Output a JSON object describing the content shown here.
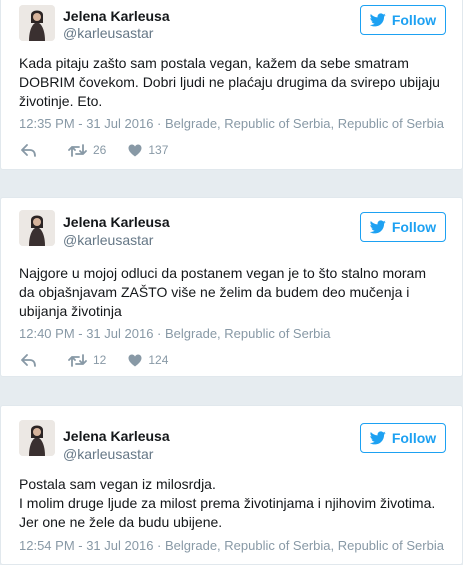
{
  "colors": {
    "accent": "#1da1f2",
    "muted": "#8899a6",
    "background": "#e6ecf0"
  },
  "tweets": [
    {
      "name": "Jelena Karleusa",
      "handle": "@karleusastar",
      "follow_label": "Follow",
      "text": "Kada pitaju zašto sam postala vegan, kažem da sebe smatram DOBRIM čovekom. Dobri ljudi ne plaćaju drugima da svirepo ubijaju životinje. Eto.",
      "time": "12:35 PM - 31 Jul 2016",
      "separator": "·",
      "location": "Belgrade, Republic of Serbia, Republic of Serbia",
      "retweets": "26",
      "likes": "137"
    },
    {
      "name": "Jelena Karleusa",
      "handle": "@karleusastar",
      "follow_label": "Follow",
      "text": "Najgore u mojoj odluci da postanem vegan je to što stalno moram da objašnjavam ZAŠTO više ne želim da budem deo mučenja i ubijanja životinja",
      "time": "12:40 PM - 31 Jul 2016",
      "separator": "·",
      "location": "Belgrade, Republic of Serbia",
      "retweets": "12",
      "likes": "124"
    },
    {
      "name": "Jelena Karleusa",
      "handle": "@karleusastar",
      "follow_label": "Follow",
      "text_lines": [
        "Postala sam vegan iz milosrdja.",
        "I molim druge ljude za milost prema životinjama i njihovim životima.",
        "Jer one ne žele da budu ubijene."
      ],
      "time": "12:54 PM - 31 Jul 2016",
      "separator": "·",
      "location": "Belgrade, Republic of Serbia, Republic of Serbia"
    }
  ]
}
